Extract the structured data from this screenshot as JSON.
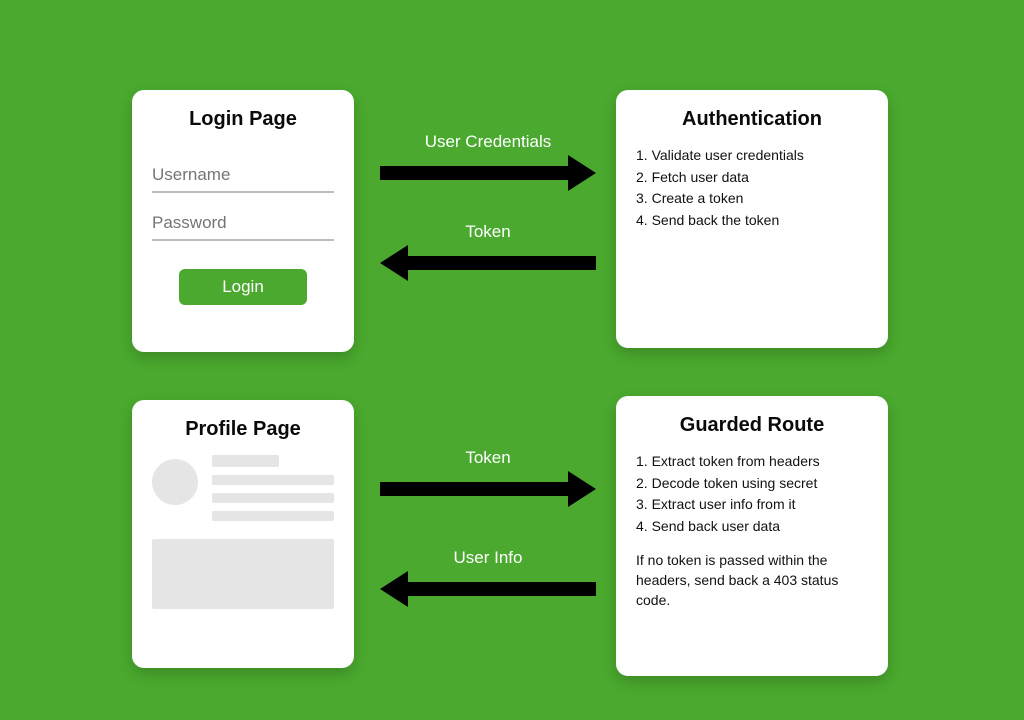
{
  "login": {
    "title": "Login Page",
    "username_placeholder": "Username",
    "password_placeholder": "Password",
    "button_label": "Login"
  },
  "auth": {
    "title": "Authentication",
    "steps": [
      "Validate user credentials",
      "Fetch user data",
      "Create a token",
      "Send back the token"
    ]
  },
  "profile": {
    "title": "Profile Page"
  },
  "guarded": {
    "title": "Guarded Route",
    "steps": [
      "Extract token from headers",
      "Decode token using secret",
      "Extract user info from it",
      "Send back user data"
    ],
    "note": "If no token is passed within the headers, send back a 403 status code."
  },
  "arrows": {
    "a1": "User Credentials",
    "a2": "Token",
    "a3": "Token",
    "a4": "User Info"
  }
}
